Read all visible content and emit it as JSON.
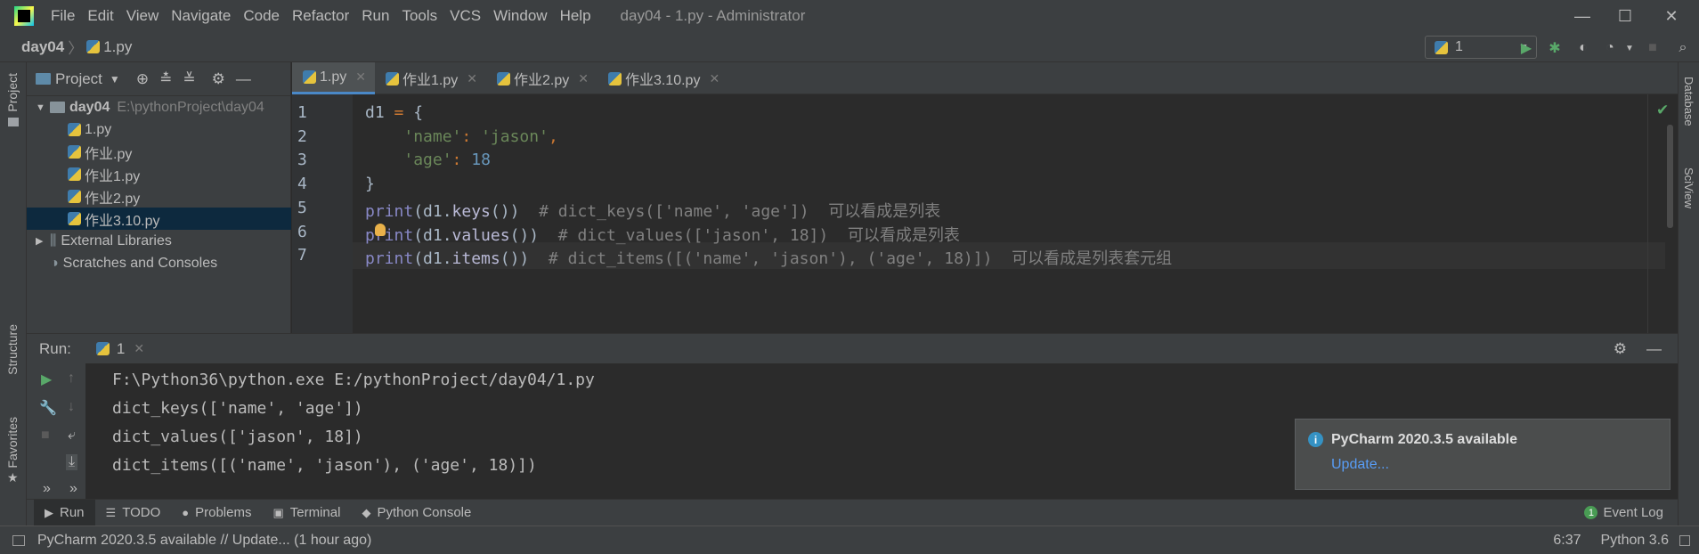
{
  "window": {
    "title": "day04 - 1.py - Administrator",
    "menu": [
      "File",
      "Edit",
      "View",
      "Navigate",
      "Code",
      "Refactor",
      "Run",
      "Tools",
      "VCS",
      "Window",
      "Help"
    ],
    "controls": {
      "minimize": "—",
      "maximize": "☐",
      "close": "✕"
    }
  },
  "nav": {
    "project": "day04",
    "separator": "〉",
    "file": "1.py",
    "run_config": "1"
  },
  "left_strip": {
    "project": "Project",
    "structure": "Structure",
    "favorites": "Favorites"
  },
  "right_strip": {
    "database": "Database",
    "sciview": "SciView"
  },
  "project_panel": {
    "title": "Project",
    "root": {
      "name": "day04",
      "path": "E:\\pythonProject\\day04"
    },
    "files": [
      "1.py",
      "作业.py",
      "作业1.py",
      "作业2.py",
      "作业3.10.py"
    ],
    "selected_index": 4,
    "external_libraries": "External Libraries",
    "scratches": "Scratches and Consoles"
  },
  "editor_tabs": [
    {
      "label": "1.py",
      "active": true
    },
    {
      "label": "作业1.py",
      "active": false
    },
    {
      "label": "作业2.py",
      "active": false
    },
    {
      "label": "作业3.10.py",
      "active": false
    }
  ],
  "editor": {
    "line_numbers": [
      "1",
      "2",
      "3",
      "4",
      "5",
      "6",
      "7"
    ],
    "highlighted_line": 6,
    "lines": [
      {
        "t": [
          [
            "d1 ",
            "plain"
          ],
          [
            "=",
            "kw-key"
          ],
          [
            " {",
            "plain"
          ]
        ]
      },
      {
        "t": [
          [
            "    ",
            "plain"
          ],
          [
            "'name'",
            "kw-str"
          ],
          [
            ": ",
            "kw-key"
          ],
          [
            "'jason'",
            "kw-str"
          ],
          [
            ",",
            "kw-key"
          ]
        ]
      },
      {
        "t": [
          [
            "    ",
            "plain"
          ],
          [
            "'age'",
            "kw-str"
          ],
          [
            ": ",
            "kw-key"
          ],
          [
            "18",
            "kw-num"
          ]
        ]
      },
      {
        "t": [
          [
            "}",
            "plain"
          ]
        ]
      },
      {
        "t": [
          [
            "print",
            "kw-fn"
          ],
          [
            "(d1.",
            "plain"
          ],
          [
            "keys",
            "kw-meth"
          ],
          [
            "())  ",
            "plain"
          ],
          [
            "# dict_keys(['name', 'age'])  可以看成是列表",
            "kw-cmt"
          ]
        ]
      },
      {
        "t": [
          [
            "print",
            "kw-fn"
          ],
          [
            "(d1.",
            "plain"
          ],
          [
            "values",
            "kw-meth"
          ],
          [
            "())  ",
            "plain"
          ],
          [
            "# dict_values(['jason', 18])  可以看成是列表",
            "kw-cmt"
          ]
        ]
      },
      {
        "t": [
          [
            "print",
            "kw-fn"
          ],
          [
            "(d1.",
            "plain"
          ],
          [
            "items",
            "kw-meth"
          ],
          [
            "())  ",
            "plain"
          ],
          [
            "# dict_items([('name', 'jason'), ('age', 18)])  可以看成是列表套元组",
            "kw-cmt"
          ]
        ]
      }
    ]
  },
  "run_panel": {
    "label": "Run:",
    "tab": "1",
    "output": [
      "F:\\Python36\\python.exe E:/pythonProject/day04/1.py",
      "dict_keys(['name', 'age'])",
      "dict_values(['jason', 18])",
      "dict_items([('name', 'jason'), ('age', 18)])"
    ]
  },
  "notification": {
    "title": "PyCharm 2020.3.5 available",
    "link": "Update..."
  },
  "tool_tabs": [
    {
      "label": "Run",
      "icon": "▶",
      "active": true
    },
    {
      "label": "TODO",
      "icon": "☰",
      "active": false
    },
    {
      "label": "Problems",
      "icon": "●",
      "active": false
    },
    {
      "label": "Terminal",
      "icon": "▣",
      "active": false
    },
    {
      "label": "Python Console",
      "icon": "◆",
      "active": false
    }
  ],
  "event_log": {
    "count": "1",
    "label": "Event Log"
  },
  "status": {
    "message": "PyCharm 2020.3.5 available // Update... (1 hour ago)",
    "position": "6:37",
    "interpreter": "Python 3.6"
  }
}
